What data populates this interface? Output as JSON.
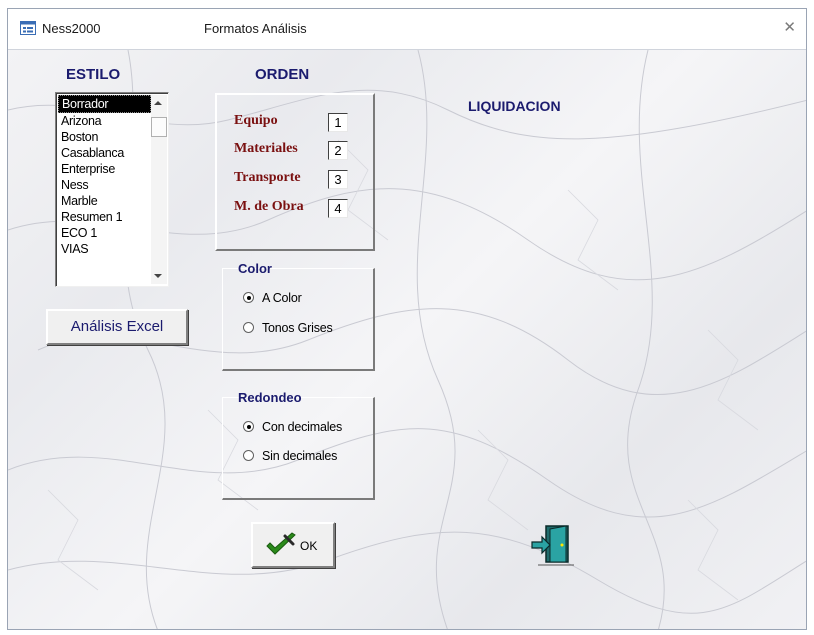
{
  "window": {
    "app_title": "Ness2000",
    "form_title": "Formatos Análisis",
    "close_glyph": "✕"
  },
  "estilo": {
    "heading": "ESTILO",
    "items": [
      "Borrador",
      "Arizona",
      "Boston",
      "Casablanca",
      "Enterprise",
      "Ness",
      "Marble",
      "Resumen 1",
      "ECO 1",
      "VIAS"
    ],
    "selected": "Borrador"
  },
  "excel_button": "Análisis Excel",
  "orden": {
    "heading": "ORDEN",
    "rows": [
      {
        "label": "Equipo",
        "value": "1"
      },
      {
        "label": "Materiales",
        "value": "2"
      },
      {
        "label": "Transporte",
        "value": "3"
      },
      {
        "label": "M. de Obra",
        "value": "4"
      }
    ]
  },
  "color_group": {
    "title": "Color",
    "options": [
      {
        "label": "A Color",
        "checked": true
      },
      {
        "label": "Tonos Grises",
        "checked": false
      }
    ]
  },
  "redondeo_group": {
    "title": "Redondeo",
    "options": [
      {
        "label": "Con decimales",
        "checked": true
      },
      {
        "label": "Sin decimales",
        "checked": false
      }
    ]
  },
  "liquidacion": "LIQUIDACION",
  "ok_button": "OK",
  "icons": {
    "app": "form-icon",
    "ok": "checkmark-icon",
    "exit": "exit-door-icon"
  },
  "colors": {
    "heading_blue": "#1b1b6e",
    "label_red": "#7a1010",
    "check_green": "#2a8a1a"
  }
}
